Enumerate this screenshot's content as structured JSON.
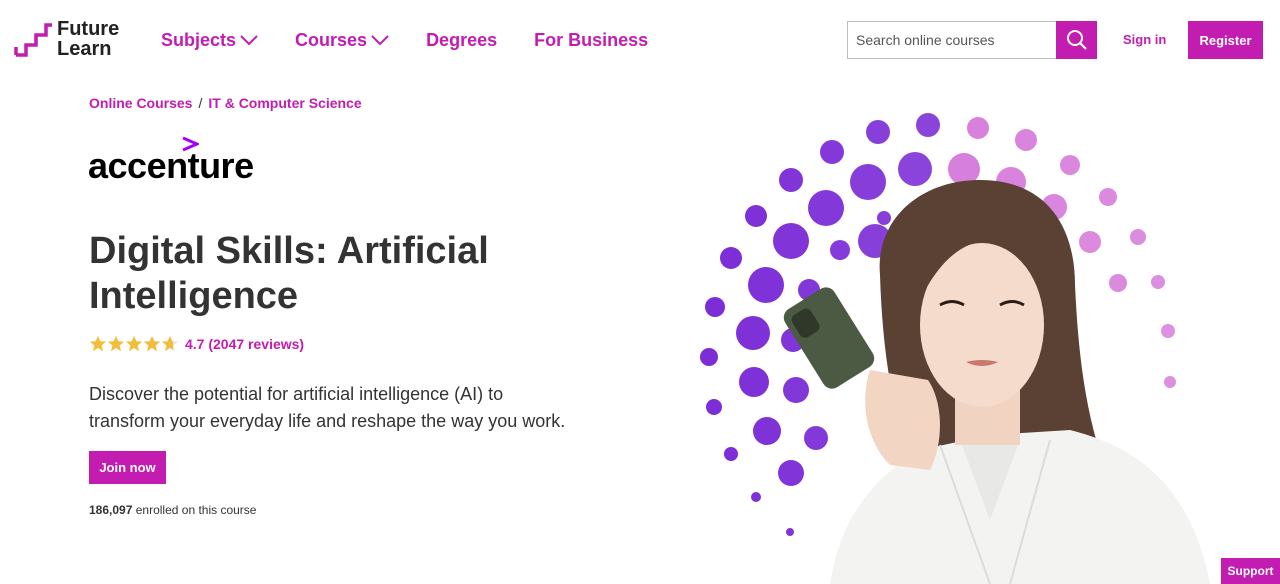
{
  "brand": {
    "line1": "Future",
    "line2": "Learn",
    "accent": "#c21cb1"
  },
  "nav": [
    {
      "label": "Subjects",
      "has_dropdown": true
    },
    {
      "label": "Courses",
      "has_dropdown": true
    },
    {
      "label": "Degrees",
      "has_dropdown": false
    },
    {
      "label": "For Business",
      "has_dropdown": false
    }
  ],
  "search": {
    "placeholder": "Search online courses",
    "icon": "search-icon"
  },
  "auth": {
    "sign_in": "Sign in",
    "register": "Register"
  },
  "breadcrumb": {
    "items": [
      "Online Courses",
      "IT & Computer Science"
    ],
    "separator": "/"
  },
  "provider": {
    "name": "accenture",
    "mark_color": "#a100ff"
  },
  "course": {
    "title": "Digital Skills: Artificial Intelligence",
    "rating": 4.7,
    "rating_text": "4.7 (2047 reviews)",
    "description": "Discover the potential for artificial intelligence (AI) to transform your everyday life and reshape the way you work.",
    "cta": "Join now",
    "enrolled_count": "186,097",
    "enrolled_text": "enrolled on this course"
  },
  "support": "Support",
  "colors": {
    "star": "#f2bd3b",
    "dots_dark": "#7a2ad6",
    "dots_light": "#d16ad6"
  }
}
